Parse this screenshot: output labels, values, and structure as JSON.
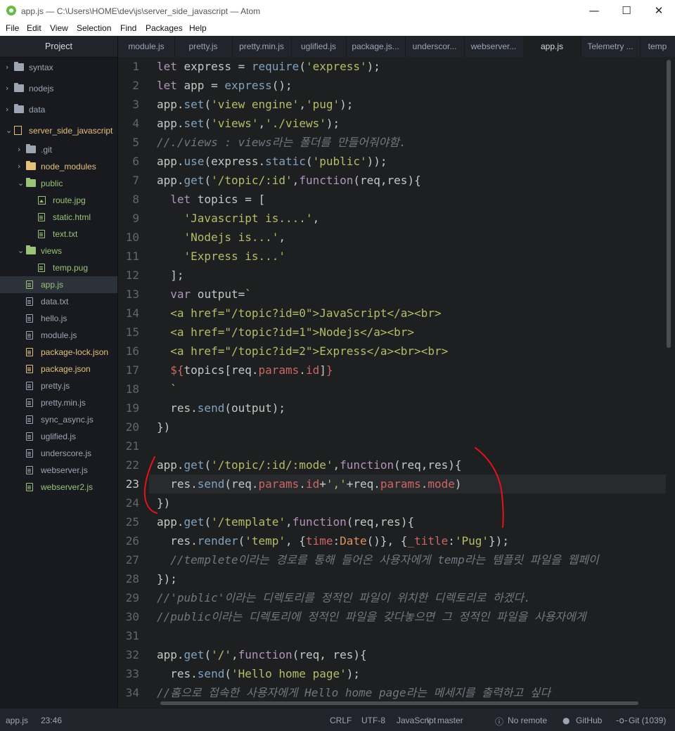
{
  "window": {
    "title": "app.js — C:\\Users\\HOME\\dev\\js\\server_side_javascript — Atom",
    "minimize": "—",
    "maximize": "☐",
    "close": "✕"
  },
  "menu": [
    "File",
    "Edit",
    "View",
    "Selection",
    "Find",
    "Packages",
    "Help"
  ],
  "sidebar": {
    "header": "Project",
    "items": [
      {
        "label": "syntax",
        "type": "folder",
        "color": "#9da5b4"
      },
      {
        "label": "nodejs",
        "type": "folder",
        "color": "#9da5b4"
      },
      {
        "label": "data",
        "type": "folder",
        "color": "#9da5b4"
      },
      {
        "label": "server_side_javascript",
        "type": "repo",
        "color": "#e5c07b"
      },
      {
        "label": ".git",
        "type": "folder",
        "color": "#9da5b4"
      },
      {
        "label": "node_modules",
        "type": "folder",
        "color": "#e5c07b"
      },
      {
        "label": "public",
        "type": "folder",
        "color": "#98c379"
      },
      {
        "label": "route.jpg",
        "type": "image",
        "color": "#98c379"
      },
      {
        "label": "static.html",
        "type": "file",
        "color": "#98c379"
      },
      {
        "label": "text.txt",
        "type": "file",
        "color": "#98c379"
      },
      {
        "label": "views",
        "type": "folder",
        "color": "#98c379"
      },
      {
        "label": "temp.pug",
        "type": "file",
        "color": "#98c379"
      },
      {
        "label": "app.js",
        "type": "file",
        "color": "#98c379"
      },
      {
        "label": "data.txt",
        "type": "file",
        "color": "#9da5b4"
      },
      {
        "label": "hello.js",
        "type": "file",
        "color": "#9da5b4"
      },
      {
        "label": "module.js",
        "type": "file",
        "color": "#9da5b4"
      },
      {
        "label": "package-lock.json",
        "type": "file",
        "color": "#e5c07b"
      },
      {
        "label": "package.json",
        "type": "file",
        "color": "#e5c07b"
      },
      {
        "label": "pretty.js",
        "type": "file",
        "color": "#9da5b4"
      },
      {
        "label": "pretty.min.js",
        "type": "file",
        "color": "#9da5b4"
      },
      {
        "label": "sync_async.js",
        "type": "file",
        "color": "#9da5b4"
      },
      {
        "label": "uglified.js",
        "type": "file",
        "color": "#9da5b4"
      },
      {
        "label": "underscore.js",
        "type": "file",
        "color": "#9da5b4"
      },
      {
        "label": "webserver.js",
        "type": "file",
        "color": "#9da5b4"
      },
      {
        "label": "webserver2.js",
        "type": "file",
        "color": "#98c379"
      }
    ]
  },
  "tabs": [
    "module.js",
    "pretty.js",
    "pretty.min.js",
    "uglified.js",
    "package.js...",
    "underscor...",
    "webserver...",
    "app.js",
    "Telemetry ...",
    "temp"
  ],
  "editor": {
    "current_line": 23,
    "lines": [
      [
        [
          "kw",
          "let"
        ],
        [
          "id",
          " express = "
        ],
        [
          "fn",
          "require"
        ],
        [
          "id",
          "("
        ],
        [
          "st",
          "'express'"
        ],
        [
          "id",
          ");"
        ]
      ],
      [
        [
          "kw",
          "let"
        ],
        [
          "id",
          " app = "
        ],
        [
          "fn",
          "express"
        ],
        [
          "id",
          "();"
        ]
      ],
      [
        [
          "id",
          "app."
        ],
        [
          "fn",
          "set"
        ],
        [
          "id",
          "("
        ],
        [
          "st",
          "'view engine'"
        ],
        [
          "id",
          ","
        ],
        [
          "st",
          "'pug'"
        ],
        [
          "id",
          ");"
        ]
      ],
      [
        [
          "id",
          "app."
        ],
        [
          "fn",
          "set"
        ],
        [
          "id",
          "("
        ],
        [
          "st",
          "'views'"
        ],
        [
          "id",
          ","
        ],
        [
          "st",
          "'./views'"
        ],
        [
          "id",
          ");"
        ]
      ],
      [
        [
          "cm",
          "//./views : views라는 폴더를 만들어줘야함."
        ]
      ],
      [
        [
          "id",
          "app."
        ],
        [
          "fn",
          "use"
        ],
        [
          "id",
          "(express."
        ],
        [
          "fn",
          "static"
        ],
        [
          "id",
          "("
        ],
        [
          "st",
          "'public'"
        ],
        [
          "id",
          "));"
        ]
      ],
      [
        [
          "id",
          "app."
        ],
        [
          "fn",
          "get"
        ],
        [
          "id",
          "("
        ],
        [
          "st",
          "'/topic/:id'"
        ],
        [
          "id",
          ","
        ],
        [
          "kw",
          "function"
        ],
        [
          "id",
          "(req,res){"
        ]
      ],
      [
        [
          "id",
          "  "
        ],
        [
          "kw",
          "let"
        ],
        [
          "id",
          " topics = ["
        ]
      ],
      [
        [
          "id",
          "    "
        ],
        [
          "st",
          "'Javascript is....'"
        ],
        [
          "id",
          ","
        ]
      ],
      [
        [
          "id",
          "    "
        ],
        [
          "st",
          "'Nodejs is...'"
        ],
        [
          "id",
          ","
        ]
      ],
      [
        [
          "id",
          "    "
        ],
        [
          "st",
          "'Express is...'"
        ]
      ],
      [
        [
          "id",
          "  ];"
        ]
      ],
      [
        [
          "id",
          "  "
        ],
        [
          "kw",
          "var"
        ],
        [
          "id",
          " output="
        ],
        [
          "st",
          "`"
        ]
      ],
      [
        [
          "st",
          "  <a href=\"/topic?id=0\">JavaScript</a><br>"
        ]
      ],
      [
        [
          "st",
          "  <a href=\"/topic?id=1\">Nodejs</a><br>"
        ]
      ],
      [
        [
          "st",
          "  <a href=\"/topic?id=2\">Express</a><br><br>"
        ]
      ],
      [
        [
          "id",
          "  "
        ],
        [
          "pr",
          "${"
        ],
        [
          "id",
          "topics[req."
        ],
        [
          "pr",
          "params"
        ],
        [
          "id",
          "."
        ],
        [
          "pr",
          "id"
        ],
        [
          "id",
          "]"
        ],
        [
          "pr",
          "}"
        ]
      ],
      [
        [
          "st",
          "  `"
        ]
      ],
      [
        [
          "id",
          "  res."
        ],
        [
          "fn",
          "send"
        ],
        [
          "id",
          "(output);"
        ]
      ],
      [
        [
          "id",
          "})"
        ]
      ],
      [],
      [
        [
          "id",
          "app."
        ],
        [
          "fn",
          "get"
        ],
        [
          "id",
          "("
        ],
        [
          "st",
          "'/topic/:id/:mode'"
        ],
        [
          "id",
          ","
        ],
        [
          "kw",
          "function"
        ],
        [
          "id",
          "(req,res){"
        ]
      ],
      [
        [
          "id",
          "  res."
        ],
        [
          "fn",
          "send"
        ],
        [
          "id",
          "(req."
        ],
        [
          "pr",
          "params"
        ],
        [
          "id",
          "."
        ],
        [
          "pr",
          "id"
        ],
        [
          "id",
          "+"
        ],
        [
          "st",
          "','"
        ],
        [
          "id",
          "+req."
        ],
        [
          "pr",
          "params"
        ],
        [
          "id",
          "."
        ],
        [
          "pr",
          "mode"
        ],
        [
          "id",
          ")"
        ]
      ],
      [
        [
          "id",
          "})"
        ]
      ],
      [
        [
          "id",
          "app."
        ],
        [
          "fn",
          "get"
        ],
        [
          "id",
          "("
        ],
        [
          "st",
          "'/template'"
        ],
        [
          "id",
          ","
        ],
        [
          "kw",
          "function"
        ],
        [
          "id",
          "(req,res){"
        ]
      ],
      [
        [
          "id",
          "  res."
        ],
        [
          "fn",
          "render"
        ],
        [
          "id",
          "("
        ],
        [
          "st",
          "'temp'"
        ],
        [
          "id",
          ", {"
        ],
        [
          "pr",
          "time"
        ],
        [
          "id",
          ":"
        ],
        [
          "tp",
          "Date"
        ],
        [
          "id",
          "()}, {"
        ],
        [
          "pr",
          "_title"
        ],
        [
          "id",
          ":"
        ],
        [
          "st",
          "'Pug'"
        ],
        [
          "id",
          "});"
        ]
      ],
      [
        [
          "cm",
          "  //templete이라는 경로를 통해 들어온 사용자에게 temp라는 템플릿 파일을 웹페이"
        ]
      ],
      [
        [
          "id",
          "});"
        ]
      ],
      [
        [
          "cm",
          "//'public'이라는 디렉토리를 정적인 파일이 위치한 디렉토리로 하겠다."
        ]
      ],
      [
        [
          "cm",
          "//public이라는 디렉토리에 정적인 파일을 갖다놓으면 그 정적인 파일을 사용자에게"
        ]
      ],
      [],
      [
        [
          "id",
          "app."
        ],
        [
          "fn",
          "get"
        ],
        [
          "id",
          "("
        ],
        [
          "st",
          "'/'"
        ],
        [
          "id",
          ","
        ],
        [
          "kw",
          "function"
        ],
        [
          "id",
          "(req, res){"
        ]
      ],
      [
        [
          "id",
          "  res."
        ],
        [
          "fn",
          "send"
        ],
        [
          "id",
          "("
        ],
        [
          "st",
          "'Hello home page'"
        ],
        [
          "id",
          ");"
        ]
      ],
      [
        [
          "cm",
          "//홈으로 접속한 사용자에게 Hello home page라는 메세지를 출력하고 싶다"
        ]
      ]
    ]
  },
  "status": {
    "file": "app.js",
    "position": "23:46",
    "line_ending": "CRLF",
    "encoding": "UTF-8",
    "grammar": "JavaScript",
    "branch": "master",
    "remote": "No remote",
    "github": "GitHub",
    "git": "Git (1039)"
  },
  "colors": {
    "annotation": "#e3131b",
    "selected_tab_marker": "#d7dae0"
  }
}
